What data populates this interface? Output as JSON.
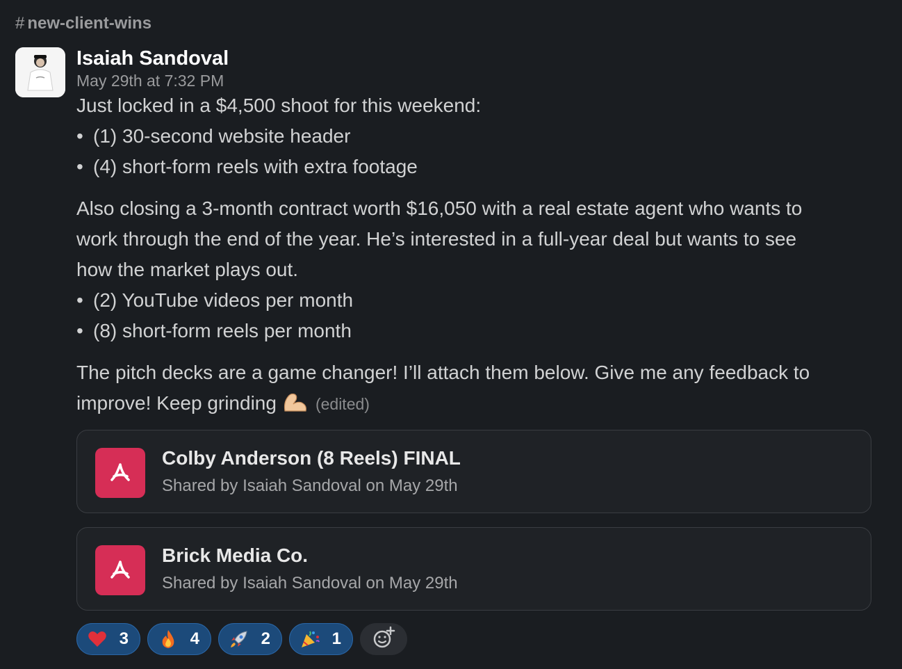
{
  "channel": {
    "hash": "#",
    "name": "new-client-wins"
  },
  "message": {
    "author": "Isaiah Sandoval",
    "timestamp": "May 29th at 7:32 PM",
    "p1": "Just locked in a $4,500 shoot for this weekend:",
    "list1": [
      "(1) 30-second website header",
      "(4) short-form reels with extra footage"
    ],
    "p2_l1": "Also closing a 3-month contract worth $16,050 with a real estate agent who wants to",
    "p2_l2": "work through the end of the year. He’s interested in a full-year deal but wants to see",
    "p2_l3": "how the market plays out.",
    "list2": [
      "(2) YouTube videos per month",
      "(8) short-form reels per month"
    ],
    "p3_l1": "The pitch decks are a game changer! I’ll attach them below. Give me any feedback to",
    "p3_l2": "improve! Keep grinding",
    "edited": "(edited)",
    "bullet": "•"
  },
  "attachments": [
    {
      "name": "Colby Anderson (8 Reels) FINAL",
      "shared": "Shared by Isaiah Sandoval on May 29th",
      "icon": "pdf-icon"
    },
    {
      "name": "Brick Media Co.",
      "shared": "Shared by Isaiah Sandoval on May 29th",
      "icon": "pdf-icon"
    }
  ],
  "reactions": [
    {
      "emoji": "heart",
      "count": "3"
    },
    {
      "emoji": "fire",
      "count": "4"
    },
    {
      "emoji": "rocket",
      "count": "2"
    },
    {
      "emoji": "party-popper",
      "count": "1"
    }
  ],
  "colors": {
    "background": "#1a1d21",
    "pdf": "#d62e56",
    "reaction": "#1c4a7a"
  }
}
